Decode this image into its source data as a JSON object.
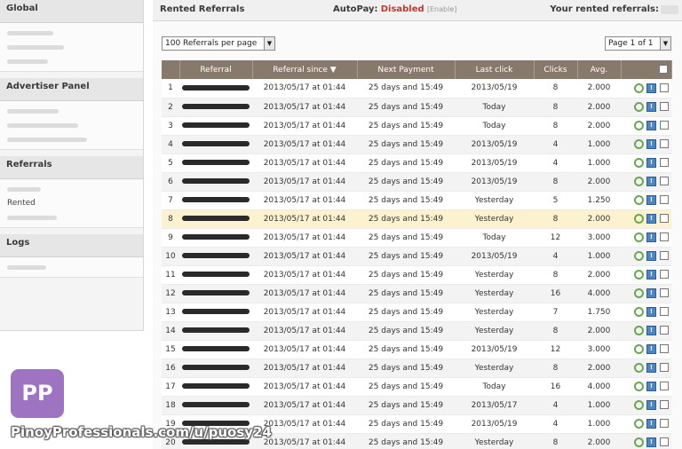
{
  "sidebar": {
    "global": {
      "title": "Global"
    },
    "advertiser": {
      "title": "Advertiser Panel"
    },
    "referrals": {
      "title": "Referrals",
      "item_rented": "Rented"
    },
    "logs": {
      "title": "Logs"
    }
  },
  "topbar": {
    "title": "Rented Referrals",
    "autopay_label": "AutoPay:",
    "autopay_status": "Disabled",
    "autopay_enable": "[Enable]",
    "rented_label": "Your rented referrals:"
  },
  "controls": {
    "per_page": "100 Referrals per page",
    "page": "Page 1 of 1"
  },
  "table": {
    "headers": [
      "Referral",
      "Referral since ▼",
      "Next Payment",
      "Last click",
      "Clicks",
      "Avg."
    ],
    "rows": [
      {
        "num": "1",
        "since": "2013/05/17 at 01:44",
        "next": "25 days and 15:49",
        "last": "2013/05/19",
        "clicks": "8",
        "avg": "2.000"
      },
      {
        "num": "2",
        "since": "2013/05/17 at 01:44",
        "next": "25 days and 15:49",
        "last": "Today",
        "clicks": "8",
        "avg": "2.000"
      },
      {
        "num": "3",
        "since": "2013/05/17 at 01:44",
        "next": "25 days and 15:49",
        "last": "Today",
        "clicks": "8",
        "avg": "2.000"
      },
      {
        "num": "4",
        "since": "2013/05/17 at 01:44",
        "next": "25 days and 15:49",
        "last": "2013/05/19",
        "clicks": "4",
        "avg": "1.000"
      },
      {
        "num": "5",
        "since": "2013/05/17 at 01:44",
        "next": "25 days and 15:49",
        "last": "2013/05/19",
        "clicks": "4",
        "avg": "1.000"
      },
      {
        "num": "6",
        "since": "2013/05/17 at 01:44",
        "next": "25 days and 15:49",
        "last": "2013/05/19",
        "clicks": "8",
        "avg": "2.000"
      },
      {
        "num": "7",
        "since": "2013/05/17 at 01:44",
        "next": "25 days and 15:49",
        "last": "Yesterday",
        "clicks": "5",
        "avg": "1.250"
      },
      {
        "num": "8",
        "since": "2013/05/17 at 01:44",
        "next": "25 days and 15:49",
        "last": "Yesterday",
        "clicks": "8",
        "avg": "2.000"
      },
      {
        "num": "9",
        "since": "2013/05/17 at 01:44",
        "next": "25 days and 15:49",
        "last": "Today",
        "clicks": "12",
        "avg": "3.000"
      },
      {
        "num": "10",
        "since": "2013/05/17 at 01:44",
        "next": "25 days and 15:49",
        "last": "2013/05/19",
        "clicks": "4",
        "avg": "1.000"
      },
      {
        "num": "11",
        "since": "2013/05/17 at 01:44",
        "next": "25 days and 15:49",
        "last": "Yesterday",
        "clicks": "8",
        "avg": "2.000"
      },
      {
        "num": "12",
        "since": "2013/05/17 at 01:44",
        "next": "25 days and 15:49",
        "last": "Yesterday",
        "clicks": "16",
        "avg": "4.000"
      },
      {
        "num": "13",
        "since": "2013/05/17 at 01:44",
        "next": "25 days and 15:49",
        "last": "Yesterday",
        "clicks": "7",
        "avg": "1.750"
      },
      {
        "num": "14",
        "since": "2013/05/17 at 01:44",
        "next": "25 days and 15:49",
        "last": "Yesterday",
        "clicks": "8",
        "avg": "2.000"
      },
      {
        "num": "15",
        "since": "2013/05/17 at 01:44",
        "next": "25 days and 15:49",
        "last": "2013/05/19",
        "clicks": "12",
        "avg": "3.000"
      },
      {
        "num": "16",
        "since": "2013/05/17 at 01:44",
        "next": "25 days and 15:49",
        "last": "Yesterday",
        "clicks": "8",
        "avg": "2.000"
      },
      {
        "num": "17",
        "since": "2013/05/17 at 01:44",
        "next": "25 days and 15:49",
        "last": "Today",
        "clicks": "16",
        "avg": "4.000"
      },
      {
        "num": "18",
        "since": "2013/05/17 at 01:44",
        "next": "25 days and 15:49",
        "last": "2013/05/17",
        "clicks": "4",
        "avg": "1.000"
      },
      {
        "num": "19",
        "since": "2013/05/17 at 01:44",
        "next": "25 days and 15:49",
        "last": "2013/05/19",
        "clicks": "4",
        "avg": "1.000"
      },
      {
        "num": "20",
        "since": "2013/05/17 at 01:44",
        "next": "25 days and 15:49",
        "last": "Yesterday",
        "clicks": "8",
        "avg": "2.000"
      }
    ],
    "highlight_row": 8,
    "icons": {
      "refresh": "refresh-icon",
      "stats": "stats-icon",
      "select": "checkbox"
    }
  },
  "watermark": {
    "logo": "PP",
    "text": "PinoyProfessionals.com/u/puosy24"
  },
  "colors": {
    "header_bg": "#877a6c",
    "highlight_row": "#fdf2cf",
    "disabled": "#c0392b",
    "logo_bg": "#8e5bb8"
  }
}
